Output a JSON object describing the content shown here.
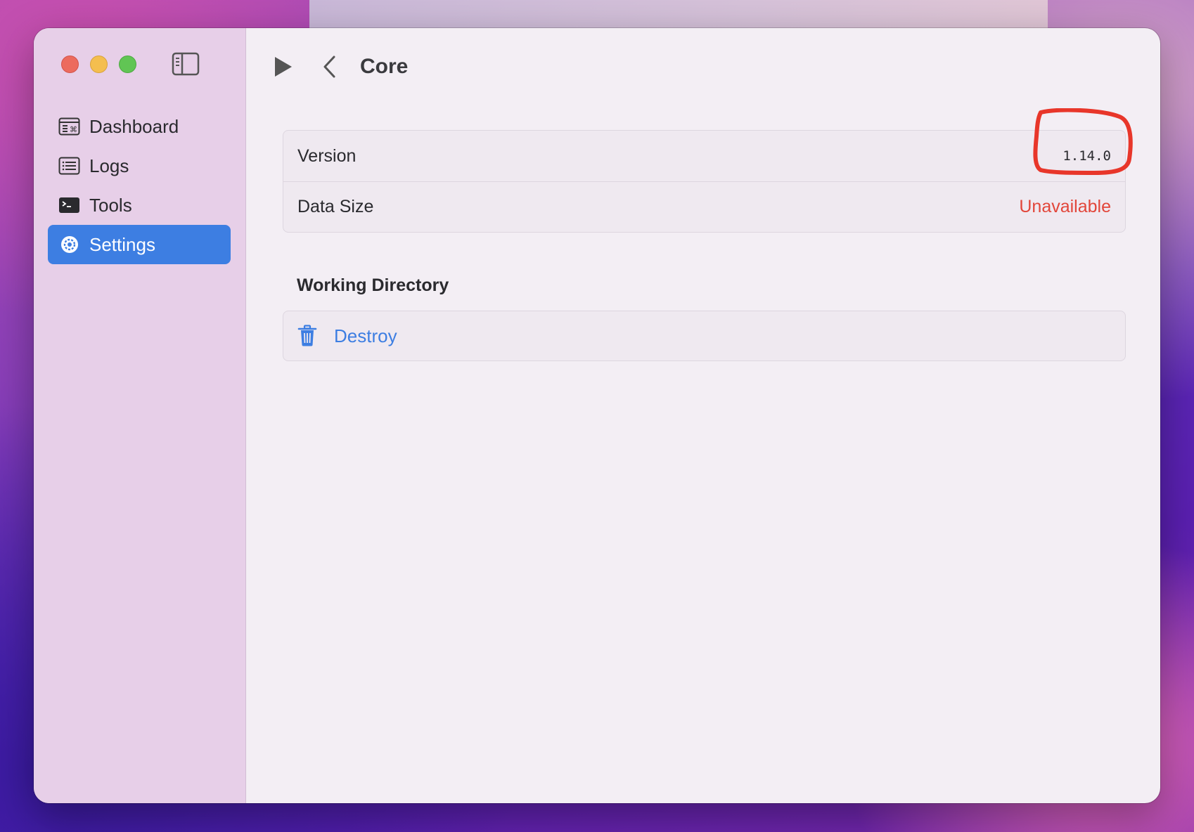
{
  "window": {
    "title": "Core"
  },
  "sidebar": {
    "items": [
      {
        "label": "Dashboard",
        "icon": "dashboard-icon",
        "active": false
      },
      {
        "label": "Logs",
        "icon": "list-icon",
        "active": false
      },
      {
        "label": "Tools",
        "icon": "terminal-icon",
        "active": false
      },
      {
        "label": "Settings",
        "icon": "gear-icon",
        "active": true
      }
    ]
  },
  "info": {
    "version_label": "Version",
    "version_value": "1.14.0",
    "data_size_label": "Data Size",
    "data_size_value": "Unavailable"
  },
  "working_directory": {
    "title": "Working Directory",
    "destroy_label": "Destroy"
  },
  "colors": {
    "accent": "#3d7ee2",
    "error": "#e2463a",
    "annotation": "#e8362a"
  }
}
